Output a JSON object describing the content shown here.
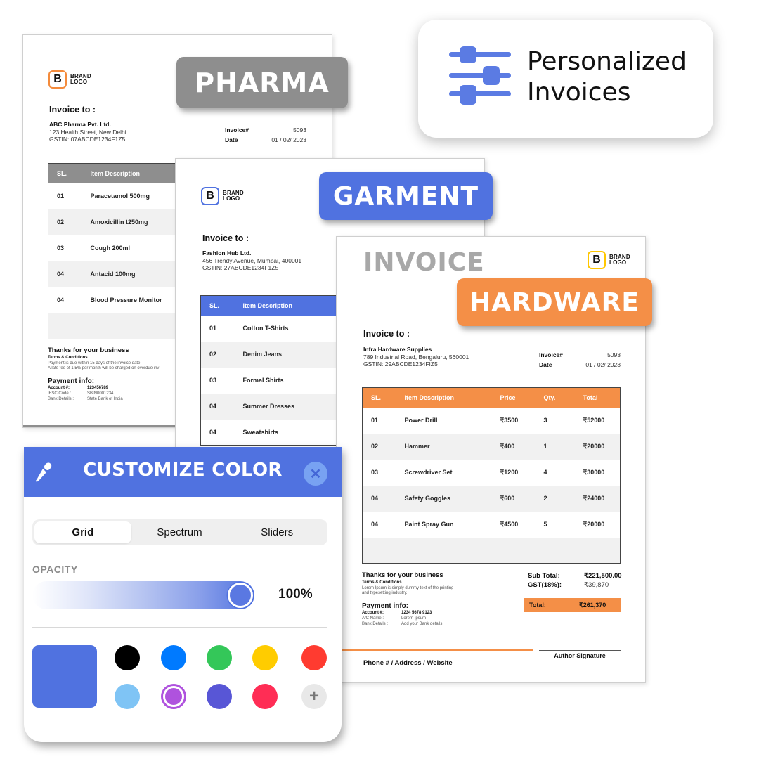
{
  "header_card": {
    "title_line1": "Personalized",
    "title_line2": "Invoices",
    "icon": "sliders-icon",
    "accent": "#5b7be3"
  },
  "tags": {
    "pharma": {
      "label": "PHARMA",
      "color": "#8e8e8e"
    },
    "garment": {
      "label": "GARMENT",
      "color": "#5072e0"
    },
    "hardware": {
      "label": "HARDWARE",
      "color": "#f48f47"
    }
  },
  "brand_logo": {
    "letter": "B",
    "line1": "BRAND",
    "line2": "LOGO"
  },
  "pharma_invoice": {
    "invoice_to_label": "Invoice to :",
    "client_name": "ABC Pharma Pvt. Ltd.",
    "client_address": "123 Health Street, New Delhi",
    "client_gstin": "GSTIN: 07ABCDE1234F1Z5",
    "invoice_no_label": "Invoice#",
    "invoice_no": "5093",
    "date_label": "Date",
    "date": "01 / 02/ 2023",
    "header_color": "#8e8e8e",
    "columns": [
      "SL.",
      "Item Description"
    ],
    "rows": [
      {
        "sl": "01",
        "desc": "Paracetamol 500mg"
      },
      {
        "sl": "02",
        "desc": "Amoxicillin t250mg"
      },
      {
        "sl": "03",
        "desc": "Cough 200ml"
      },
      {
        "sl": "04",
        "desc": "Antacid 100mg"
      },
      {
        "sl": "04",
        "desc": "Blood Pressure Monitor"
      }
    ],
    "thanks": "Thanks for your business",
    "terms_title": "Terms & Conditions",
    "terms_line1": "Payment is due within 15 days of the invoice date",
    "terms_line2": "A late fee of 1.5% per month will be charged on overdue inv",
    "payment_title": "Payment info:",
    "payment": [
      {
        "label": "Account #:",
        "value": "123456789"
      },
      {
        "label": "IFSC Code :",
        "value": "SBIN0001234"
      },
      {
        "label": "Bank Details :",
        "value": "State Bank of India"
      }
    ]
  },
  "garment_invoice": {
    "invoice_to_label": "Invoice to :",
    "client_name": "Fashion Hub Ltd.",
    "client_address": "456 Trendy Avenue, Mumbai, 400001",
    "client_gstin": "GSTIN: 27ABCDE1234F1Z5",
    "header_color": "#5072e0",
    "columns": [
      "SL.",
      "Item Description"
    ],
    "rows": [
      {
        "sl": "01",
        "desc": "Cotton T-Shirts"
      },
      {
        "sl": "02",
        "desc": "Denim Jeans"
      },
      {
        "sl": "03",
        "desc": "Formal Shirts"
      },
      {
        "sl": "04",
        "desc": "Summer Dresses"
      },
      {
        "sl": "04",
        "desc": "Sweatshirts"
      }
    ]
  },
  "hardware_invoice": {
    "title": "INVOICE",
    "invoice_to_label": "Invoice to :",
    "client_name": "Infra Hardware Supplies",
    "client_address": "789 Industrial Road, Bengaluru, 560001",
    "client_gstin": "GSTIN: 29ABCDE1234FIZ5",
    "invoice_no_label": "Invoice#",
    "invoice_no": "5093",
    "date_label": "Date",
    "date": "01 / 02/ 2023",
    "header_color": "#f48f47",
    "columns": [
      "SL.",
      "Item Description",
      "Price",
      "Qty.",
      "Total"
    ],
    "rows": [
      {
        "sl": "01",
        "desc": "Power Drill",
        "price": "₹3500",
        "qty": "3",
        "total": "₹52000"
      },
      {
        "sl": "02",
        "desc": "Hammer",
        "price": "₹400",
        "qty": "1",
        "total": "₹20000"
      },
      {
        "sl": "03",
        "desc": "Screwdriver Set",
        "price": "₹1200",
        "qty": "4",
        "total": "₹30000"
      },
      {
        "sl": "04",
        "desc": "Safety Goggles",
        "price": "₹600",
        "qty": "2",
        "total": "₹24000"
      },
      {
        "sl": "04",
        "desc": "Paint Spray Gun",
        "price": "₹4500",
        "qty": "5",
        "total": "₹20000"
      }
    ],
    "thanks": "Thanks for your business",
    "terms_title": "Terms & Conditions",
    "terms_line1": "Lorem Ipsum is simply dummy text of the printing",
    "terms_line2": "and typesetting industry.",
    "payment_title": "Payment info:",
    "payment": [
      {
        "label": "Account #:",
        "value": "1234 5678 9123"
      },
      {
        "label": "A/C Name :",
        "value": "Lorem Ipsum"
      },
      {
        "label": "Bank Details :",
        "value": "Add your Bank details"
      }
    ],
    "subtotal_label": "Sub Total:",
    "subtotal": "₹221,500.00",
    "gst_label": "GST(18%):",
    "gst": "₹39,870",
    "total_label": "Total:",
    "total": "₹261,370",
    "footer_contact": "Phone # / Address / Website",
    "signature_label": "Author Signature"
  },
  "color_panel": {
    "title": "CUSTOMIZE COLOR",
    "tabs": [
      {
        "label": "Grid",
        "active": true
      },
      {
        "label": "Spectrum",
        "active": false
      },
      {
        "label": "Sliders",
        "active": false
      }
    ],
    "opacity_label": "OPACITY",
    "opacity_value": "100%",
    "opacity_fraction": 1.0,
    "current_color": "#5072e0",
    "swatches": [
      {
        "name": "black",
        "color": "#000000"
      },
      {
        "name": "blue",
        "color": "#007aff"
      },
      {
        "name": "green",
        "color": "#34c759"
      },
      {
        "name": "yellow",
        "color": "#ffcc00"
      },
      {
        "name": "red",
        "color": "#ff3b30"
      },
      {
        "name": "light-blue",
        "color": "#7fc4f5"
      },
      {
        "name": "purple",
        "color": "#af52de",
        "selected": true
      },
      {
        "name": "indigo",
        "color": "#5856d6"
      },
      {
        "name": "pink",
        "color": "#ff2d55"
      }
    ],
    "add_label": "+"
  }
}
